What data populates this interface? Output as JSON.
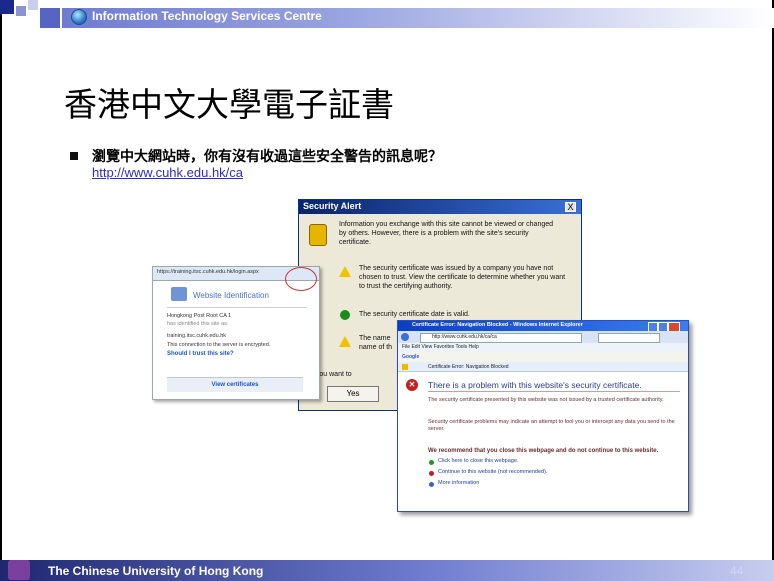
{
  "header": {
    "brand": "Information Technology Services Centre"
  },
  "slide": {
    "title": "香港中文大學電子証書",
    "question": "瀏覽中大網站時，你有沒有收過這些安全警告的訊息呢？",
    "link": "http://www.cuhk.edu.hk/ca"
  },
  "security_alert": {
    "title": "Security Alert",
    "close": "X",
    "intro": "Information you exchange with this site cannot be viewed or changed by others. However, there is a problem with the site's security certificate.",
    "item1": "The security certificate was issued by a company you have not chosen to trust. View the certificate to determine whether you want to trust the certifying authority.",
    "item2": "The security certificate date is valid.",
    "item3_a": "The name",
    "item3_b": "name of th",
    "question_partial": "Do you want to",
    "yes": "Yes"
  },
  "website_identification": {
    "url": "https://training.itsc.cuhk.edu.hk/login.aspx",
    "title": "Website Identification",
    "ca": "Hongkong Post Root CA 1",
    "ca_sub": "has identified this site as:",
    "site": "training.itsc.cuhk.edu.hk",
    "encrypted": "This connection to the server is encrypted.",
    "trust_link": "Should I trust this site?",
    "view_button": "View certificates"
  },
  "ie_window": {
    "title": "Certificate Error: Navigation Blocked - Windows Internet Explorer",
    "address": "http://www.cuhk.edu.hk/ca/ca",
    "menu": "File  Edit  View  Favorites  Tools  Help",
    "search": "Google",
    "tab": "Certificate Error: Navigation Blocked",
    "heading": "There is a problem with this website's security certificate.",
    "para1": "The security certificate presented by this website was not issued by a trusted certificate authority.",
    "para2": "Security certificate problems may indicate an attempt to fool you or intercept any data you send to the server.",
    "recommend": "We recommend that you close this webpage and do not continue to this website.",
    "link1": "Click here to close this webpage.",
    "link2": "Continue to this website (not recommended).",
    "link3": "More information"
  },
  "footer": {
    "university": "The Chinese University of Hong Kong",
    "page": "44"
  }
}
